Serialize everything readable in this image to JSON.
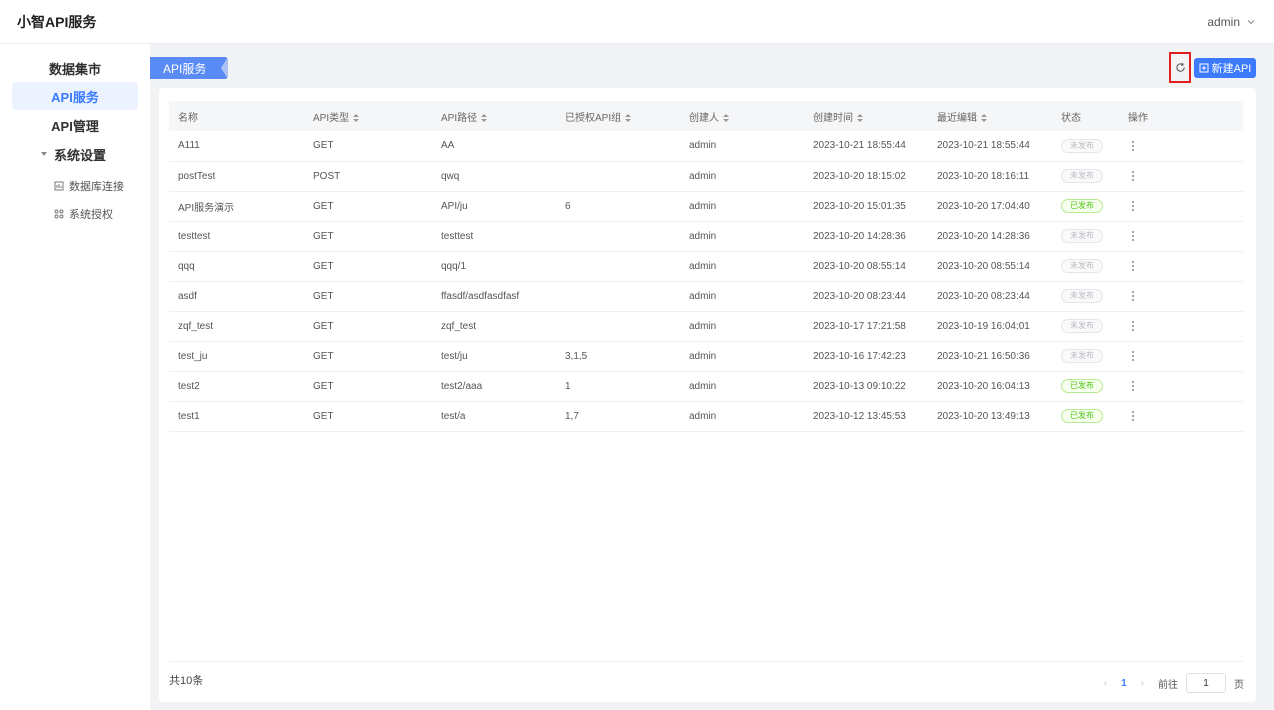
{
  "app": {
    "title": "小智API服务",
    "user": "admin"
  },
  "sidebar": {
    "items": [
      {
        "label": "数据集市"
      },
      {
        "label": "API服务"
      },
      {
        "label": "API管理"
      }
    ],
    "group": {
      "label": "系统设置"
    },
    "sub_items": [
      {
        "label": "数据库连接",
        "icon": "database-icon"
      },
      {
        "label": "系统授权",
        "icon": "authorize-icon"
      }
    ]
  },
  "main": {
    "tab_label": "API服务",
    "new_button_label": "新建API",
    "colors": {
      "accent": "#3c7bff",
      "highlight": "#e02020",
      "published": "#52c41a"
    }
  },
  "table": {
    "headers": [
      "名称",
      "API类型",
      "API路径",
      "已授权API组",
      "创建人",
      "创建时间",
      "最近编辑",
      "状态",
      "操作"
    ],
    "rows": [
      [
        "A111",
        "GET",
        "AA",
        "",
        "admin",
        "2023-10-21 18:55:44",
        "2023-10-21 18:55:44",
        "未发布"
      ],
      [
        "postTest",
        "POST",
        "qwq",
        "",
        "admin",
        "2023-10-20 18:15:02",
        "2023-10-20 18:16:11",
        "未发布"
      ],
      [
        "API服务演示",
        "GET",
        "API/ju",
        "6",
        "admin",
        "2023-10-20 15:01:35",
        "2023-10-20 17:04:40",
        "已发布"
      ],
      [
        "testtest",
        "GET",
        "testtest",
        "",
        "admin",
        "2023-10-20 14:28:36",
        "2023-10-20 14:28:36",
        "未发布"
      ],
      [
        "qqq",
        "GET",
        "qqq/1",
        "",
        "admin",
        "2023-10-20 08:55:14",
        "2023-10-20 08:55:14",
        "未发布"
      ],
      [
        "asdf",
        "GET",
        "ffasdf/asdfasdfasf",
        "",
        "admin",
        "2023-10-20 08:23:44",
        "2023-10-20 08:23:44",
        "未发布"
      ],
      [
        "zqf_test",
        "GET",
        "zqf_test",
        "",
        "admin",
        "2023-10-17 17:21:58",
        "2023-10-19 16:04:01",
        "未发布"
      ],
      [
        "test_ju",
        "GET",
        "test/ju",
        "3,1,5",
        "admin",
        "2023-10-16 17:42:23",
        "2023-10-21 16:50:36",
        "未发布"
      ],
      [
        "test2",
        "GET",
        "test2/aaa",
        "1",
        "admin",
        "2023-10-13 09:10:22",
        "2023-10-20 16:04:13",
        "已发布"
      ],
      [
        "test1",
        "GET",
        "test/a",
        "1,7",
        "admin",
        "2023-10-12 13:45:53",
        "2023-10-20 13:49:13",
        "已发布"
      ]
    ]
  },
  "pagination": {
    "total": "共10条",
    "current_page": "1",
    "goto_label": "前往",
    "goto_value": "1",
    "page_suffix": "页"
  }
}
